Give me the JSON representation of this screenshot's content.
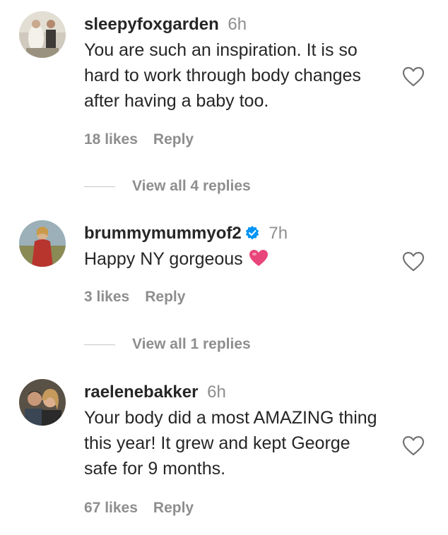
{
  "comments": [
    {
      "username": "sleepyfoxgarden",
      "time": "6h",
      "text": "You are such an inspiration. It is so hard to work through body changes after having a baby too.",
      "likes": "18 likes",
      "reply": "Reply",
      "view_replies": "View all 4 replies"
    },
    {
      "username": "brummymummyof2",
      "verified": true,
      "time": "7h",
      "text": "Happy NY gorgeous",
      "emoji": "pink-heart-emoji",
      "likes": "3 likes",
      "reply": "Reply",
      "view_replies": "View all 1 replies"
    },
    {
      "username": "raelenebakker",
      "time": "6h",
      "text": "Your body did a most AMAZING thing this year! It grew and kept George safe for 9 months.",
      "likes": "67 likes",
      "reply": "Reply"
    }
  ],
  "colors": {
    "text": "#262626",
    "secondary": "#8e8e8e",
    "verified": "#0095f6",
    "emoji_heart": "#e8457a"
  },
  "icons": {
    "like": "heart-outline-icon",
    "verified": "verified-badge-icon"
  }
}
